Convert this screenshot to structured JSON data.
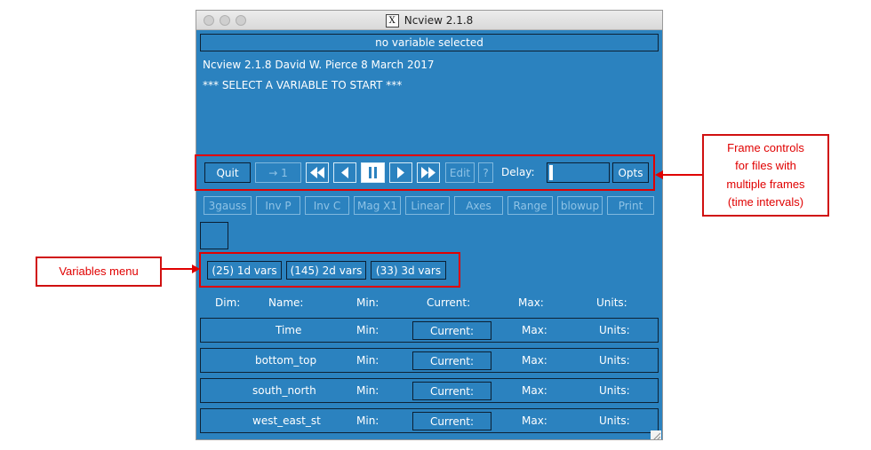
{
  "window": {
    "title": "Ncview 2.1.8",
    "x_icon": "X",
    "status": "no variable selected",
    "info_line1": "Ncview 2.1.8 David W. Pierce  8 March 2017",
    "info_line2": "*** SELECT A VARIABLE TO START ***"
  },
  "controls": {
    "quit": "Quit",
    "to_first": "→ 1",
    "edit": "Edit",
    "help": "?",
    "delay_label": "Delay:",
    "opts": "Opts",
    "icons": [
      "rewind-fast-icon",
      "step-back-icon",
      "pause-icon",
      "step-forward-icon",
      "fast-forward-icon"
    ]
  },
  "toolbar2": [
    "3gauss",
    "Inv P",
    "Inv C",
    "Mag X1",
    "Linear",
    "Axes",
    "Range",
    "blowup",
    "Print"
  ],
  "vars_menu": [
    "(25) 1d vars",
    "(145) 2d vars",
    "(33) 3d vars"
  ],
  "dim_header": {
    "dim": "Dim:",
    "name": "Name:",
    "min": "Min:",
    "current": "Current:",
    "max": "Max:",
    "units": "Units:"
  },
  "dims": [
    {
      "name": "Time",
      "min": "Min:",
      "current": "Current:",
      "max": "Max:",
      "units": "Units:"
    },
    {
      "name": "bottom_top",
      "min": "Min:",
      "current": "Current:",
      "max": "Max:",
      "units": "Units:"
    },
    {
      "name": "south_north",
      "min": "Min:",
      "current": "Current:",
      "max": "Max:",
      "units": "Units:"
    },
    {
      "name": "west_east_st",
      "min": "Min:",
      "current": "Current:",
      "max": "Max:",
      "units": "Units:"
    }
  ],
  "annotations": {
    "variables_menu": "Variables menu",
    "frame_controls": [
      "Frame controls",
      "for files with",
      "multiple frames",
      "(time intervals)"
    ]
  },
  "colors": {
    "window_bg": "#2b82bf",
    "annotation_red": "#e00000"
  }
}
